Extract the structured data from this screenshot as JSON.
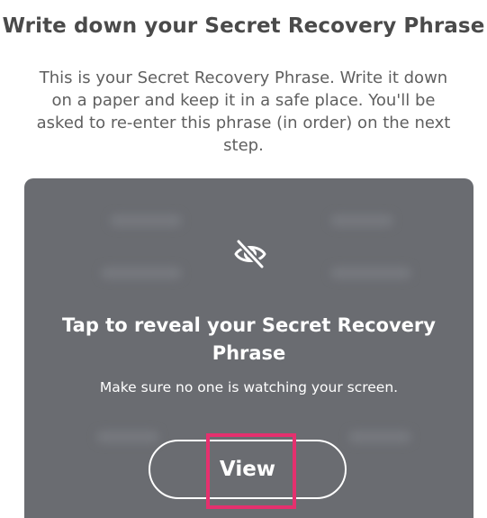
{
  "header": {
    "title": "Write down your Secret Recovery Phrase",
    "description": "This is your Secret Recovery Phrase. Write it down on a paper and keep it in a safe place. You'll be asked to re-enter this phrase (in order) on the next step."
  },
  "reveal_card": {
    "icon": "eye-off-icon",
    "title": "Tap to reveal your Secret Recovery Phrase",
    "subtitle": "Make sure no one is watching your screen.",
    "view_button_label": "View"
  },
  "colors": {
    "card_background": "#6a6c71",
    "highlight_border": "#e5306e",
    "title_text": "#4a4a4a"
  }
}
